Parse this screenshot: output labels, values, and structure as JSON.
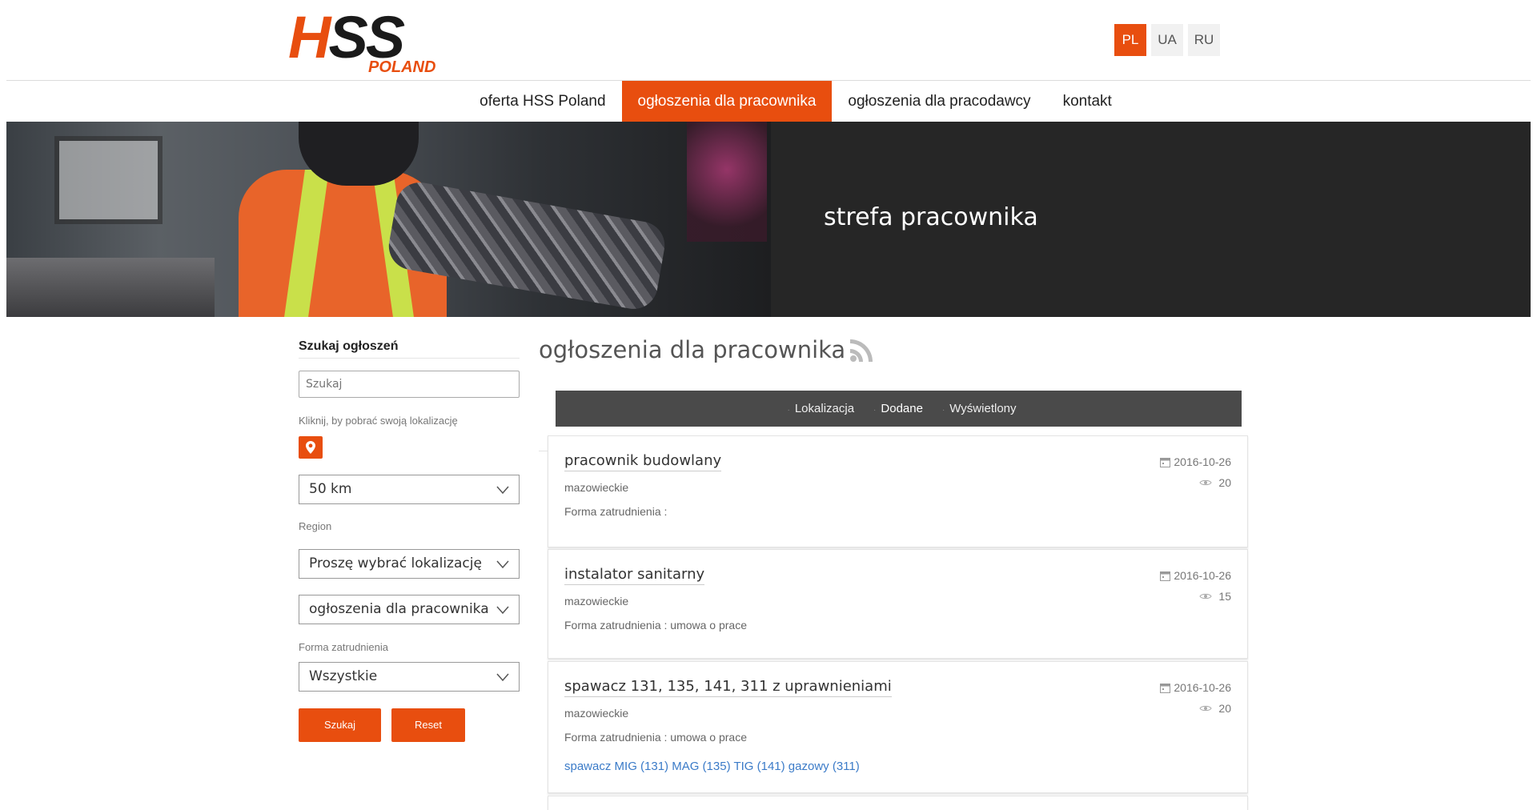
{
  "logo": {
    "letter_h": "H",
    "letters_ss": "SS",
    "sub": "POLAND"
  },
  "languages": [
    {
      "code": "PL",
      "active": true
    },
    {
      "code": "UA",
      "active": false
    },
    {
      "code": "RU",
      "active": false
    }
  ],
  "nav": {
    "items": [
      {
        "label": "oferta HSS Poland",
        "active": false
      },
      {
        "label": "ogłoszenia dla pracownika",
        "active": true
      },
      {
        "label": "ogłoszenia dla pracodawcy",
        "active": false
      },
      {
        "label": "kontakt",
        "active": false
      }
    ]
  },
  "hero": {
    "title": "strefa pracownika"
  },
  "sidebar": {
    "title": "Szukaj ogłoszeń",
    "search_placeholder": "Szukaj",
    "location_label": "Kliknij, by pobrać swoją lokalizację",
    "radius_selected": "50 km",
    "region_label": "Region",
    "region_selected": "Proszę wybrać lokalizację",
    "type_selected": "ogłoszenia dla pracownika",
    "forma_label": "Forma zatrudnienia",
    "forma_selected": "Wszystkie",
    "search_button": "Szukaj",
    "reset_button": "Reset"
  },
  "main": {
    "title": "ogłoszenia dla pracownika",
    "sort": {
      "items": [
        {
          "label": "Lokalizacja",
          "active": false
        },
        {
          "label": "Dodane",
          "active": true
        },
        {
          "label": "Wyświetlony",
          "active": false
        }
      ]
    },
    "listings": [
      {
        "title": "pracownik budowlany",
        "region": "mazowieckie",
        "forma": "Forma zatrudnienia :",
        "date": "2016-10-26",
        "views": "20",
        "desc": ""
      },
      {
        "title": "instalator sanitarny",
        "region": "mazowieckie",
        "forma": "Forma zatrudnienia : umowa o prace",
        "date": "2016-10-26",
        "views": "15",
        "desc": ""
      },
      {
        "title": "spawacz 131, 135, 141, 311 z uprawnieniami",
        "region": "mazowieckie",
        "forma": "Forma zatrudnienia : umowa o prace",
        "date": "2016-10-26",
        "views": "20",
        "desc": "spawacz MIG (131) MAG (135) TIG (141) gazowy (311)"
      }
    ]
  },
  "colors": {
    "accent": "#e84e0f",
    "sortbar": "#4a4a4a",
    "hero_bg": "#262626",
    "link": "#3b7bc8"
  }
}
